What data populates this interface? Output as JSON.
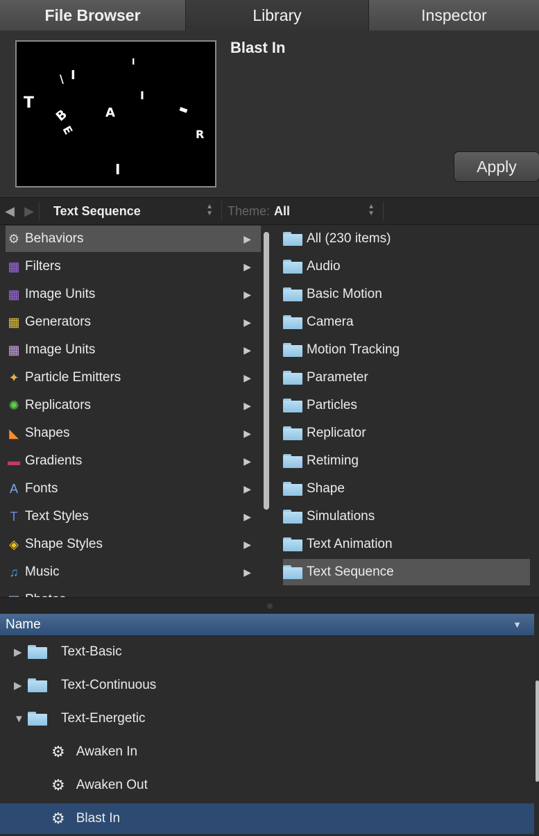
{
  "tabs": [
    "File Browser",
    "Library",
    "Inspector"
  ],
  "preview": {
    "title": "Blast In",
    "apply_label": "Apply",
    "letters": [
      "T",
      "B",
      "E",
      "A",
      "R",
      "\\",
      "I",
      "I",
      "I",
      "I"
    ]
  },
  "filterbar": {
    "back_arrow": "◀",
    "forward_arrow": "▶",
    "category": "Text Sequence",
    "theme_label": "Theme:",
    "theme_value": "All"
  },
  "left_items": [
    {
      "label": "Behaviors",
      "icon": "gear-icon",
      "glyph": "⚙",
      "color": "#d8d8d8"
    },
    {
      "label": "Filters",
      "icon": "filters-icon",
      "glyph": "▦",
      "color": "#9b6ad8"
    },
    {
      "label": "Image Units",
      "icon": "image-units-icon",
      "glyph": "▦",
      "color": "#9b6ad8"
    },
    {
      "label": "Generators",
      "icon": "generators-icon",
      "glyph": "▦",
      "color": "#e0c040"
    },
    {
      "label": "Image Units",
      "icon": "image-units-icon",
      "glyph": "▦",
      "color": "#c9a0e0"
    },
    {
      "label": "Particle Emitters",
      "icon": "particle-emitters-icon",
      "glyph": "✦",
      "color": "#e2b24a"
    },
    {
      "label": "Replicators",
      "icon": "replicators-icon",
      "glyph": "✺",
      "color": "#5fd14a"
    },
    {
      "label": "Shapes",
      "icon": "shapes-icon",
      "glyph": "◣",
      "color": "#ff8a2a"
    },
    {
      "label": "Gradients",
      "icon": "gradients-icon",
      "glyph": "▬",
      "color": "#c23a6a"
    },
    {
      "label": "Fonts",
      "icon": "fonts-icon",
      "glyph": "A",
      "color": "#7aa8f0"
    },
    {
      "label": "Text Styles",
      "icon": "text-styles-icon",
      "glyph": "T",
      "color": "#6a8ee0"
    },
    {
      "label": "Shape Styles",
      "icon": "shape-styles-icon",
      "glyph": "◈",
      "color": "#f0c020"
    },
    {
      "label": "Music",
      "icon": "music-icon",
      "glyph": "♫",
      "color": "#3aa0f0"
    },
    {
      "label": "Photos",
      "icon": "photos-icon",
      "glyph": "▤",
      "color": "#8ab0d8"
    }
  ],
  "right_items": [
    "All (230 items)",
    "Audio",
    "Basic Motion",
    "Camera",
    "Motion Tracking",
    "Parameter",
    "Particles",
    "Replicator",
    "Retiming",
    "Shape",
    "Simulations",
    "Text Animation",
    "Text Sequence"
  ],
  "list": {
    "header": "Name",
    "sort_glyph": "▼",
    "rows": [
      {
        "label": "Text-Basic",
        "type": "folder",
        "disclosure": "▶"
      },
      {
        "label": "Text-Continuous",
        "type": "folder",
        "disclosure": "▶"
      },
      {
        "label": "Text-Energetic",
        "type": "folder",
        "disclosure": "▼"
      },
      {
        "label": "Awaken In",
        "type": "behavior"
      },
      {
        "label": "Awaken Out",
        "type": "behavior"
      },
      {
        "label": "Blast In",
        "type": "behavior"
      }
    ]
  },
  "colors": {
    "selection_blue": "#2d4a72",
    "folder_blue": "#a8d4ee"
  }
}
